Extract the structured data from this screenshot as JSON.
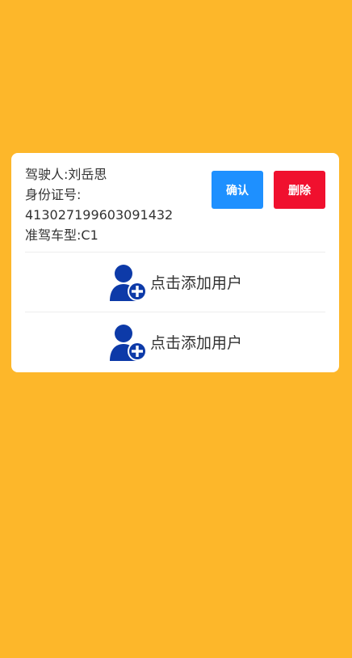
{
  "driver": {
    "name_line": "驾驶人:刘岳思",
    "id_label": "身份证号:",
    "id_number": "413027199603091432",
    "license_line": "准驾车型:C1"
  },
  "actions": {
    "confirm_label": "确认",
    "delete_label": "删除"
  },
  "add_user_rows": [
    {
      "label": "点击添加用户",
      "icon": "add-user-icon"
    },
    {
      "label": "点击添加用户",
      "icon": "add-user-icon"
    }
  ],
  "colors": {
    "background": "#FDB72A",
    "confirm": "#1E90FF",
    "delete": "#F0102E",
    "icon": "#0D3AA8"
  }
}
